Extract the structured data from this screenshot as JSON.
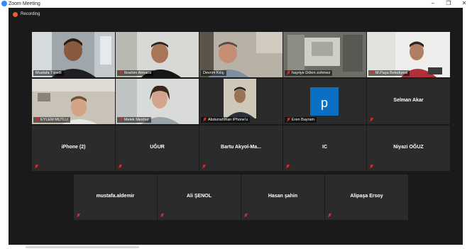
{
  "window": {
    "title": "Zoom Meeting",
    "minimize_glyph": "–",
    "restore_glyph": "❐",
    "close_glyph": "✕"
  },
  "meeting": {
    "recording_label": "Recording"
  },
  "video_participants": [
    {
      "name": "Mustafa Türedi",
      "muted": false,
      "active_speaker": true
    },
    {
      "name": "İbrahim Atmaca",
      "muted": true,
      "active_speaker": false
    },
    {
      "name": "Devrim Kılıç",
      "muted": false,
      "active_speaker": false
    },
    {
      "name": "hayriye Dölen zohmez",
      "muted": true,
      "active_speaker": false
    },
    {
      "name": "M.Paşa Belediyesi",
      "muted": true,
      "active_speaker": false
    },
    {
      "name": "EYLEM MUTLU",
      "muted": true,
      "active_speaker": false
    },
    {
      "name": "Melek Meshur",
      "muted": true,
      "active_speaker": false
    },
    {
      "name": "Abdurrahman iPhone'u",
      "muted": true,
      "active_speaker": false
    },
    {
      "name": "Eren Bayram",
      "muted": true,
      "active_speaker": false,
      "avatar_letter": "p"
    }
  ],
  "name_only_participants": [
    {
      "name": "Selman Akar",
      "muted": true
    },
    {
      "name": "iPhone (2)",
      "muted": true
    },
    {
      "name": "UĞUR",
      "muted": true
    },
    {
      "name": "Bartu  Akyol-Ma...",
      "muted": true
    },
    {
      "name": "IC",
      "muted": true
    },
    {
      "name": "Niyazi OĞUZ",
      "muted": true
    },
    {
      "name": "mustafa.aldemir",
      "muted": true
    },
    {
      "name": "Ali ŞENOL",
      "muted": true
    },
    {
      "name": "Hasan şahin",
      "muted": true
    },
    {
      "name": "Alipaşa Ersoy",
      "muted": true
    }
  ],
  "colors": {
    "meeting_bg": "#1a1a1a",
    "tile_bg": "#2b2b2b",
    "active_speaker_border": "#c9e265",
    "muted_icon": "#e02828",
    "recording_dot": "#e8612c",
    "avatar_blue": "#0b6fc4"
  }
}
